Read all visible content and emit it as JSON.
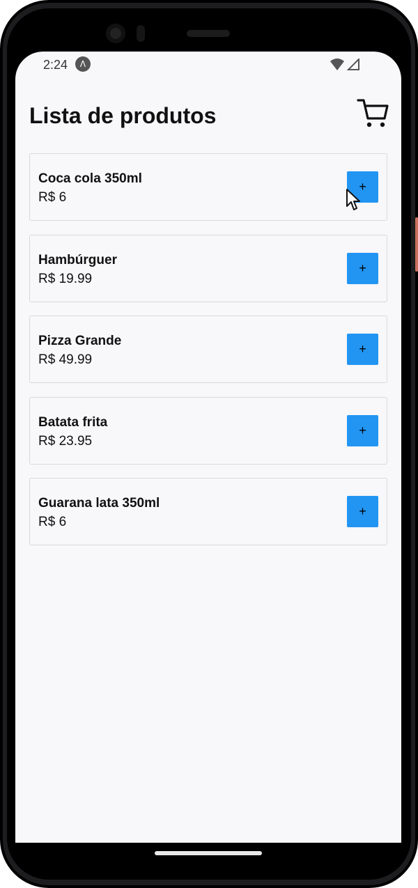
{
  "status_bar": {
    "time": "2:24",
    "app_icon_glyph": "Λ"
  },
  "header": {
    "title": "Lista de produtos",
    "cart_icon": "shopping-cart-icon"
  },
  "products": [
    {
      "name": "Coca cola 350ml",
      "price": "R$ 6",
      "add_label": "+"
    },
    {
      "name": "Hambúrguer",
      "price": "R$ 19.99",
      "add_label": "+"
    },
    {
      "name": "Pizza Grande",
      "price": "R$ 49.99",
      "add_label": "+"
    },
    {
      "name": "Batata frita",
      "price": "R$ 23.95",
      "add_label": "+"
    },
    {
      "name": "Guarana lata 350ml",
      "price": "R$ 6",
      "add_label": "+"
    }
  ],
  "colors": {
    "accent": "#2295f3",
    "screen_background": "#f8f7fa",
    "card_border": "#d9d9dc"
  }
}
